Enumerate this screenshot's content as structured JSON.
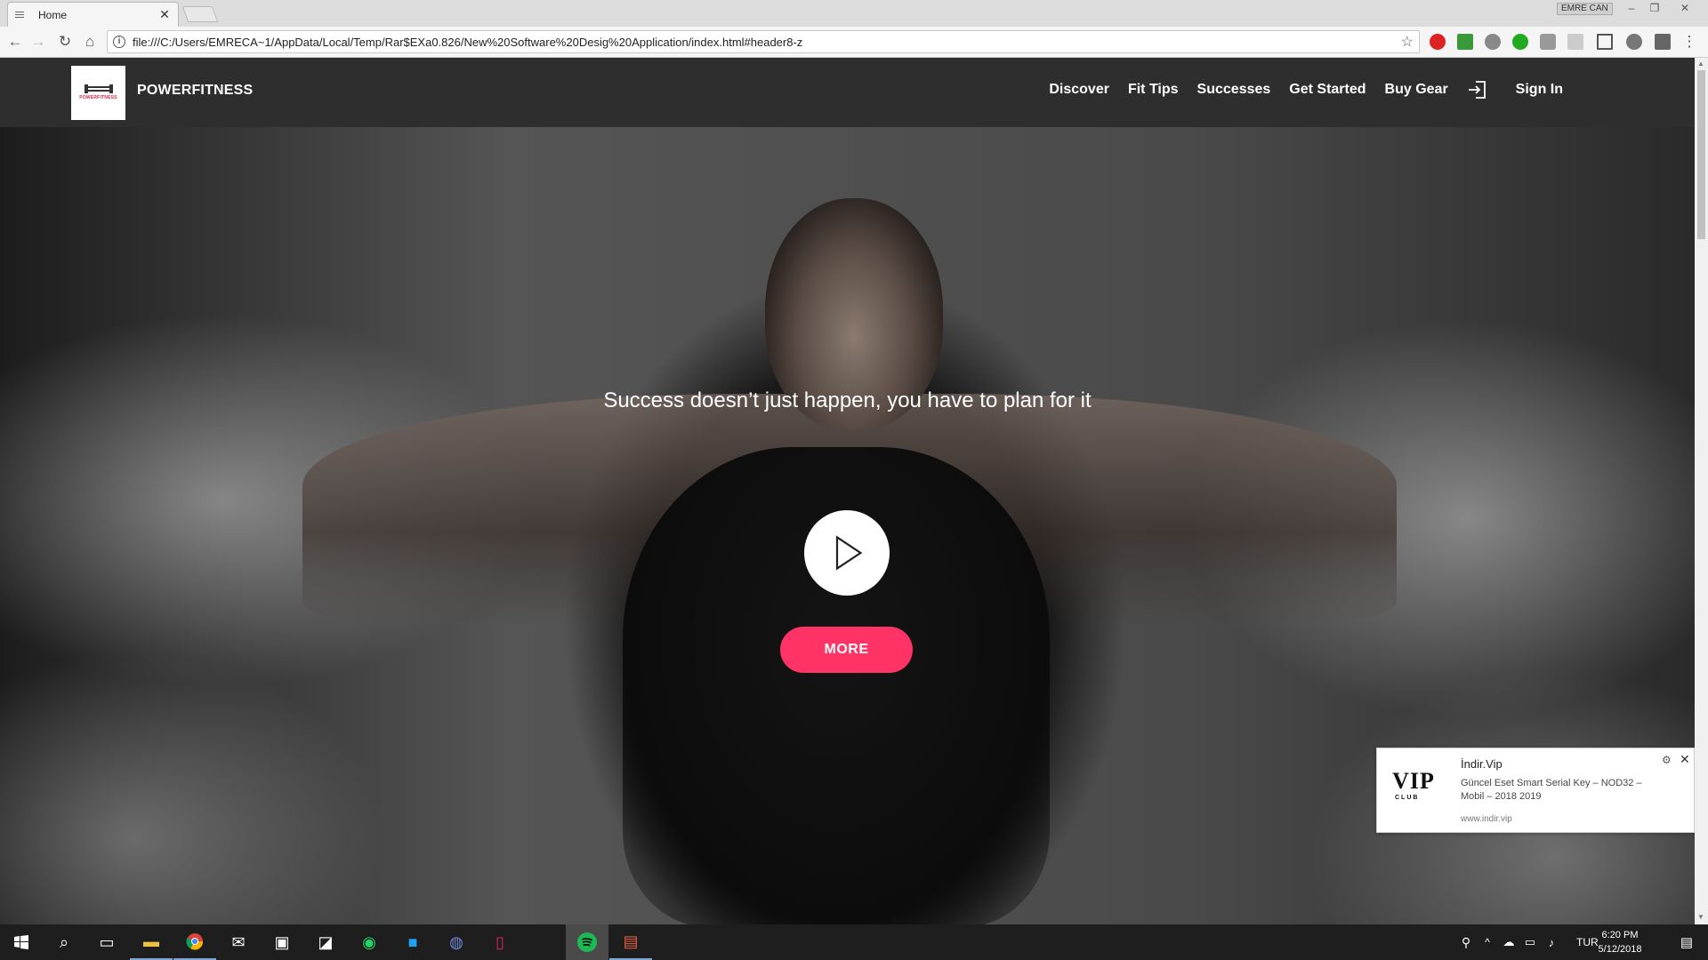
{
  "browser": {
    "tab_title": "Home",
    "user_badge": "EMRE CAN",
    "url": "file:///C:/Users/EMRECA~1/AppData/Local/Temp/Rar$EXa0.826/New%20Software%20Desig%20Application/index.html#header8-z",
    "window_controls": [
      "–",
      "❐",
      "✕"
    ]
  },
  "site": {
    "logo_text": "POWERFITNESS",
    "brand": "POWERFITNESS",
    "menu": [
      "Discover",
      "Fit Tips",
      "Successes",
      "Get Started",
      "Buy Gear"
    ],
    "signin_label": "Sign In"
  },
  "hero": {
    "headline": "Success doesn’t just happen, you have to plan for it",
    "more_label": "MORE"
  },
  "notification": {
    "logo_text": "VIP",
    "logo_sub": "CLUB",
    "title": "İndir.Vip",
    "body": "Güncel Eset Smart Serial Key – NOD32 – Mobil – 2018 2019",
    "site": "www.indir.vip"
  },
  "taskbar": {
    "language": "TUR",
    "time": "6:20 PM",
    "date": "5/12/2018"
  },
  "colors": {
    "accent": "#ff3366",
    "nav_bg": "#2e2e2e"
  }
}
